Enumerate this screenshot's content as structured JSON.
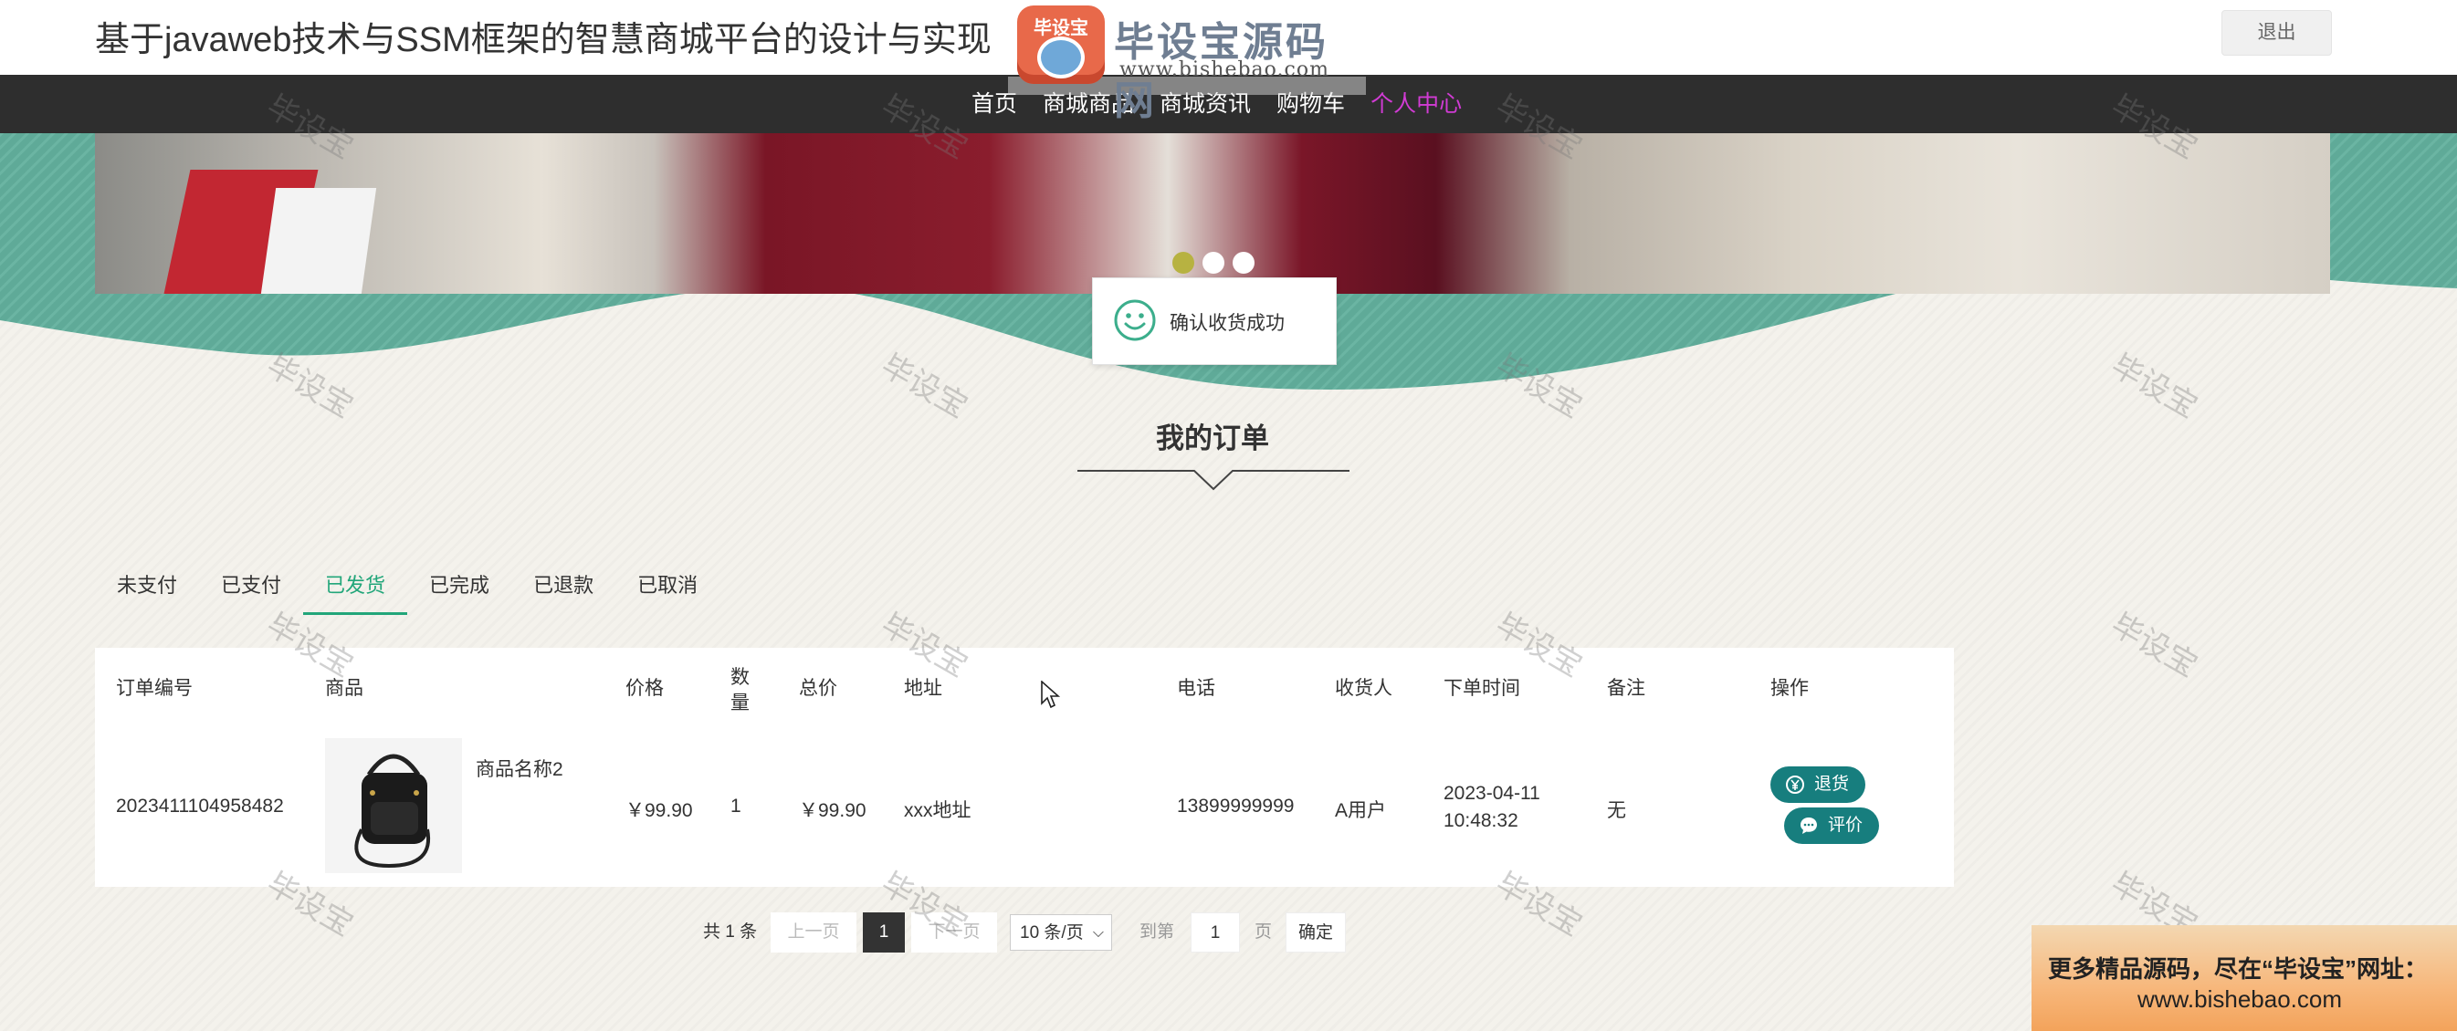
{
  "header": {
    "site_title": "基于javaweb技术与SSM框架的智慧商城平台的设计与实现",
    "logout_label": "退出",
    "logo_badge_text": "毕设宝",
    "logo_text": "毕设宝源码网",
    "logo_url": "www.bishebao.com"
  },
  "nav": {
    "items": [
      {
        "label": "首页"
      },
      {
        "label": "商城商品"
      },
      {
        "label": "商城资讯"
      },
      {
        "label": "购物车"
      },
      {
        "label": "个人中心"
      }
    ]
  },
  "toast": {
    "text": "确认收货成功"
  },
  "section": {
    "title": "我的订单"
  },
  "tabs": [
    {
      "label": "未支付"
    },
    {
      "label": "已支付"
    },
    {
      "label": "已发货"
    },
    {
      "label": "已完成"
    },
    {
      "label": "已退款"
    },
    {
      "label": "已取消"
    }
  ],
  "active_tab": "已发货",
  "table": {
    "headers": {
      "order_no": "订单编号",
      "product": "商品",
      "price": "价格",
      "quantity_1": "数",
      "quantity_2": "量",
      "total": "总价",
      "address": "地址",
      "phone": "电话",
      "receiver": "收货人",
      "order_time": "下单时间",
      "remark": "备注",
      "action": "操作"
    },
    "rows": [
      {
        "order_no": "2023411104958482",
        "product_name": "商品名称2",
        "price": "￥99.90",
        "quantity": "1",
        "total": "￥99.90",
        "address": "xxx地址",
        "phone": "13899999999",
        "receiver": "A用户",
        "order_date": "2023-04-11",
        "order_clock": "10:48:32",
        "remark": "无",
        "return_label": "退货",
        "review_label": "评价"
      }
    ]
  },
  "pagination": {
    "total_text": "共 1 条",
    "prev_label": "上一页",
    "current_page": "1",
    "next_label": "下一页",
    "page_size_label": "10 条/页",
    "goto_label": "到第",
    "goto_value": "1",
    "page_unit": "页",
    "confirm_label": "确定"
  },
  "watermark_text": "毕设宝",
  "ad": {
    "line1": "更多精品源码，尽在“毕设宝”网址：",
    "line2": "www.bishebao.com"
  },
  "colors": {
    "nav_bg": "#2e2e2e",
    "nav_active": "#d13bd4",
    "tab_active": "#22a67a",
    "action_button": "#177e7e",
    "banner_teal": "#5faa98"
  },
  "banner_slides": 3,
  "banner_active_slide": 1
}
